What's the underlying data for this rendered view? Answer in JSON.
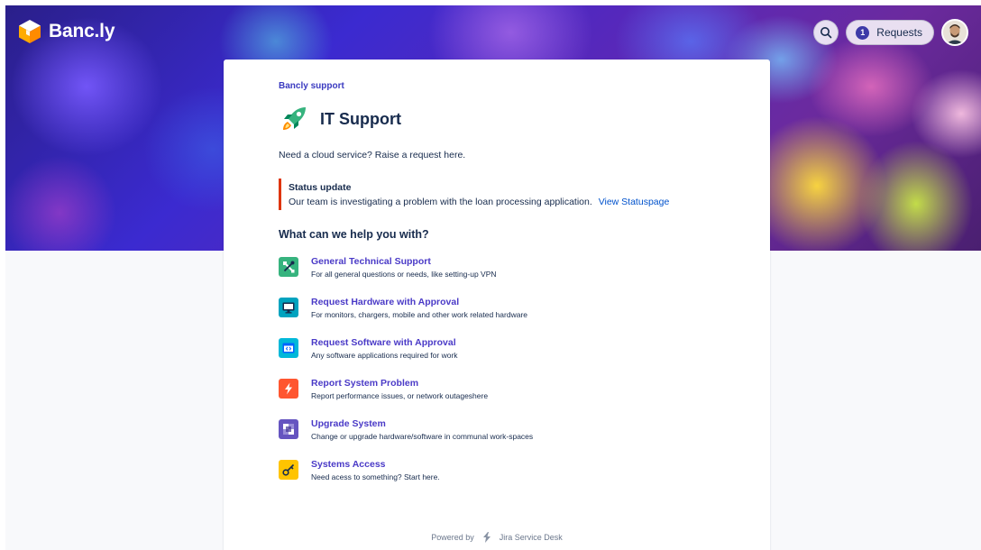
{
  "header": {
    "logo_text": "Banc.ly",
    "requests_count": "1",
    "requests_label": "Requests"
  },
  "portal": {
    "breadcrumb": "Bancly support",
    "title": "IT Support",
    "description": "Need a cloud service? Raise a request here.",
    "status": {
      "title": "Status update",
      "body": "Our team is investigating a problem with the loan processing application.",
      "link": "View Statuspage"
    },
    "help_heading": "What can we help you with?",
    "request_types": [
      {
        "name": "General Technical Support",
        "description": "For all general questions or needs, like setting-up VPN",
        "icon": "tools-icon",
        "color": "#36b37e"
      },
      {
        "name": "Request Hardware with Approval",
        "description": "For monitors, chargers, mobile and other work related hardware",
        "icon": "monitor-icon",
        "color": "#00a3bf"
      },
      {
        "name": "Request Software with Approval",
        "description": "Any software applications required for work",
        "icon": "code-window-icon",
        "color": "#00b8d9"
      },
      {
        "name": "Report System Problem",
        "description": "Report performance issues, or network outageshere",
        "icon": "lightning-icon",
        "color": "#ff5630"
      },
      {
        "name": "Upgrade System",
        "description": "Change or upgrade hardware/software in communal work-spaces",
        "icon": "checker-icon",
        "color": "#6554c0"
      },
      {
        "name": "Systems Access",
        "description": "Need acess to something? Start here.",
        "icon": "key-icon",
        "color": "#ffc400"
      }
    ]
  },
  "footer": {
    "powered_by": "Powered by",
    "product": "Jira Service Desk"
  },
  "colors": {
    "accent": "#4a3ac7",
    "link": "#0052cc",
    "status_bar": "#de350b"
  }
}
